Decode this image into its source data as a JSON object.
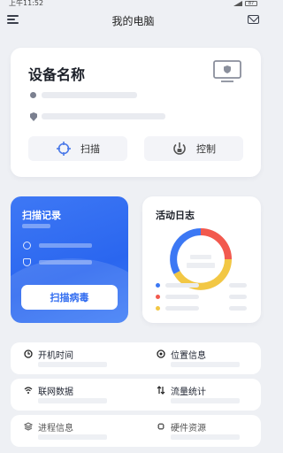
{
  "status": {
    "time": "上午11:52",
    "battery": "87"
  },
  "header": {
    "title": "我的电脑"
  },
  "device": {
    "name": "设备名称",
    "scan_label": "扫描",
    "control_label": "控制"
  },
  "scan_card": {
    "title": "扫描记录",
    "button_label": "扫描病毒"
  },
  "log_card": {
    "title": "活动日志"
  },
  "info": {
    "boot_time": "开机时间",
    "location": "位置信息",
    "network": "联网数据",
    "traffic": "流量统计",
    "process": "进程信息",
    "hardware": "硬件资源"
  },
  "colors": {
    "accent": "#2f6bf0",
    "donut_red": "#f2594e",
    "donut_yellow": "#f2c744",
    "donut_blue": "#3c78f4"
  }
}
